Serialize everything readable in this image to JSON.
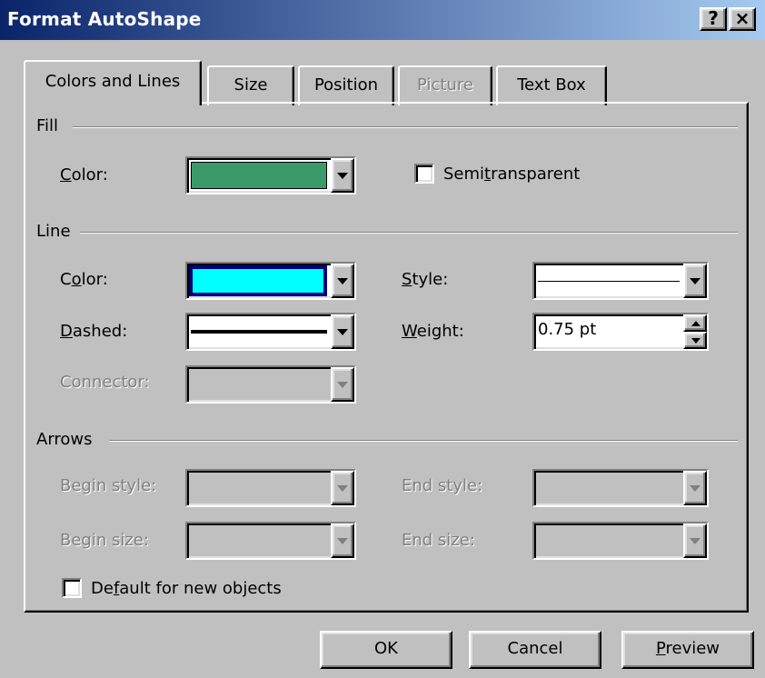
{
  "window": {
    "title": "Format AutoShape",
    "help_glyph": "?",
    "close_glyph": "×"
  },
  "tabs": [
    {
      "label": "Colors and Lines",
      "state": "active"
    },
    {
      "label": "Size",
      "state": "normal"
    },
    {
      "label": "Position",
      "state": "normal"
    },
    {
      "label": "Picture",
      "state": "disabled"
    },
    {
      "label": "Text Box",
      "state": "normal"
    }
  ],
  "fill": {
    "group_label": "Fill",
    "color_label_pre": "",
    "color_label_u": "C",
    "color_label_post": "olor:",
    "color_value": "#3a9a6a",
    "semitransparent_pre": "Semi",
    "semitransparent_u": "t",
    "semitransparent_post": "ransparent",
    "semitransparent_checked": false
  },
  "line": {
    "group_label": "Line",
    "color_label_pre": "C",
    "color_label_u": "o",
    "color_label_post": "lor:",
    "color_value": "#00ffff",
    "style_label_pre": "",
    "style_label_u": "S",
    "style_label_post": "tyle:",
    "dashed_label_pre": "",
    "dashed_label_u": "D",
    "dashed_label_post": "ashed:",
    "weight_label_pre": "",
    "weight_label_u": "W",
    "weight_label_post": "eight:",
    "weight_value": "0.75 pt",
    "connector_label": "Connector:"
  },
  "arrows": {
    "group_label": "Arrows",
    "begin_style_label": "Begin style:",
    "end_style_label": "End style:",
    "begin_size_label": "Begin size:",
    "end_size_label": "End size:"
  },
  "default": {
    "label_pre": "De",
    "label_u": "f",
    "label_post": "ault for new objects",
    "checked": false
  },
  "buttons": {
    "ok": "OK",
    "cancel": "Cancel",
    "preview_u": "P",
    "preview_post": "review"
  },
  "colors": {
    "titlebar_start": "#0a246a",
    "titlebar_end": "#a6caf0",
    "face": "#c0c0c0",
    "disabled_text": "#808080"
  }
}
